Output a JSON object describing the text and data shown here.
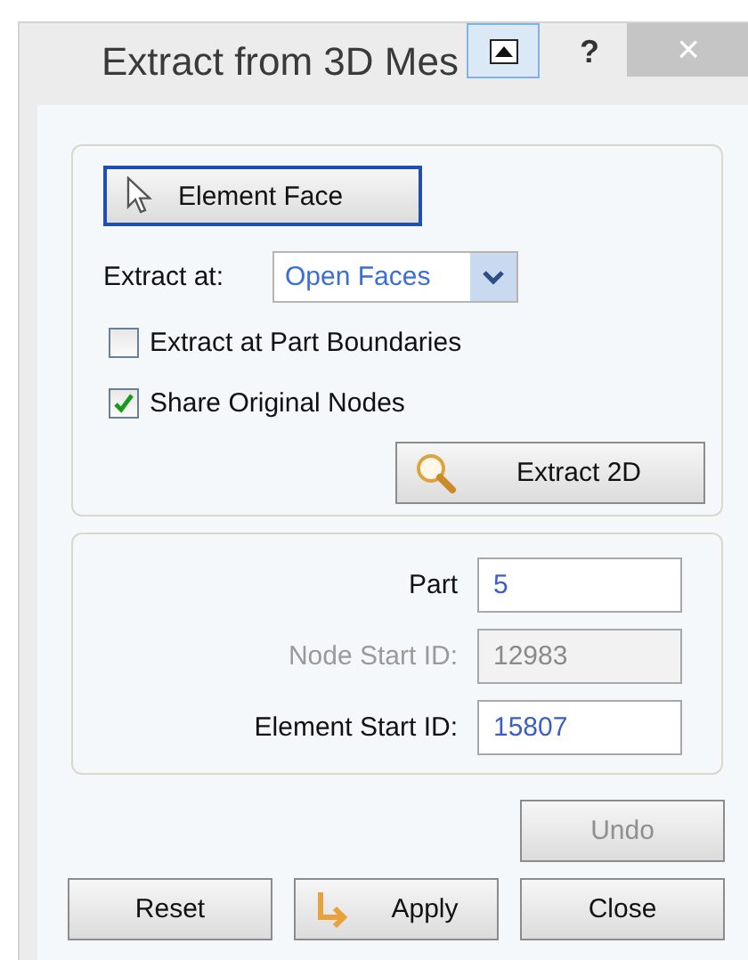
{
  "window": {
    "title": "Extract from 3D Mes",
    "help_button": "?",
    "close_button": "×"
  },
  "selection_button": {
    "label": "Element Face",
    "selected": true
  },
  "extract_at": {
    "label": "Extract at:",
    "value": "Open Faces"
  },
  "options": [
    {
      "label": "Extract at Part Boundaries",
      "checked": false
    },
    {
      "label": "Share Original Nodes",
      "checked": true
    }
  ],
  "extract_button": {
    "label": "Extract 2D"
  },
  "fields": [
    {
      "label": "Part",
      "value": "5",
      "disabled": false
    },
    {
      "label": "Node Start ID:",
      "value": "12983",
      "disabled": true
    },
    {
      "label": "Element Start ID:",
      "value": "15807",
      "disabled": false
    }
  ],
  "buttons": [
    {
      "kind": "undo",
      "label": "Undo",
      "disabled": true
    },
    {
      "kind": "plain",
      "label": "Reset",
      "disabled": false
    },
    {
      "kind": "apply",
      "label": "Apply",
      "disabled": false
    },
    {
      "kind": "plain",
      "label": "Close",
      "disabled": false
    }
  ]
}
